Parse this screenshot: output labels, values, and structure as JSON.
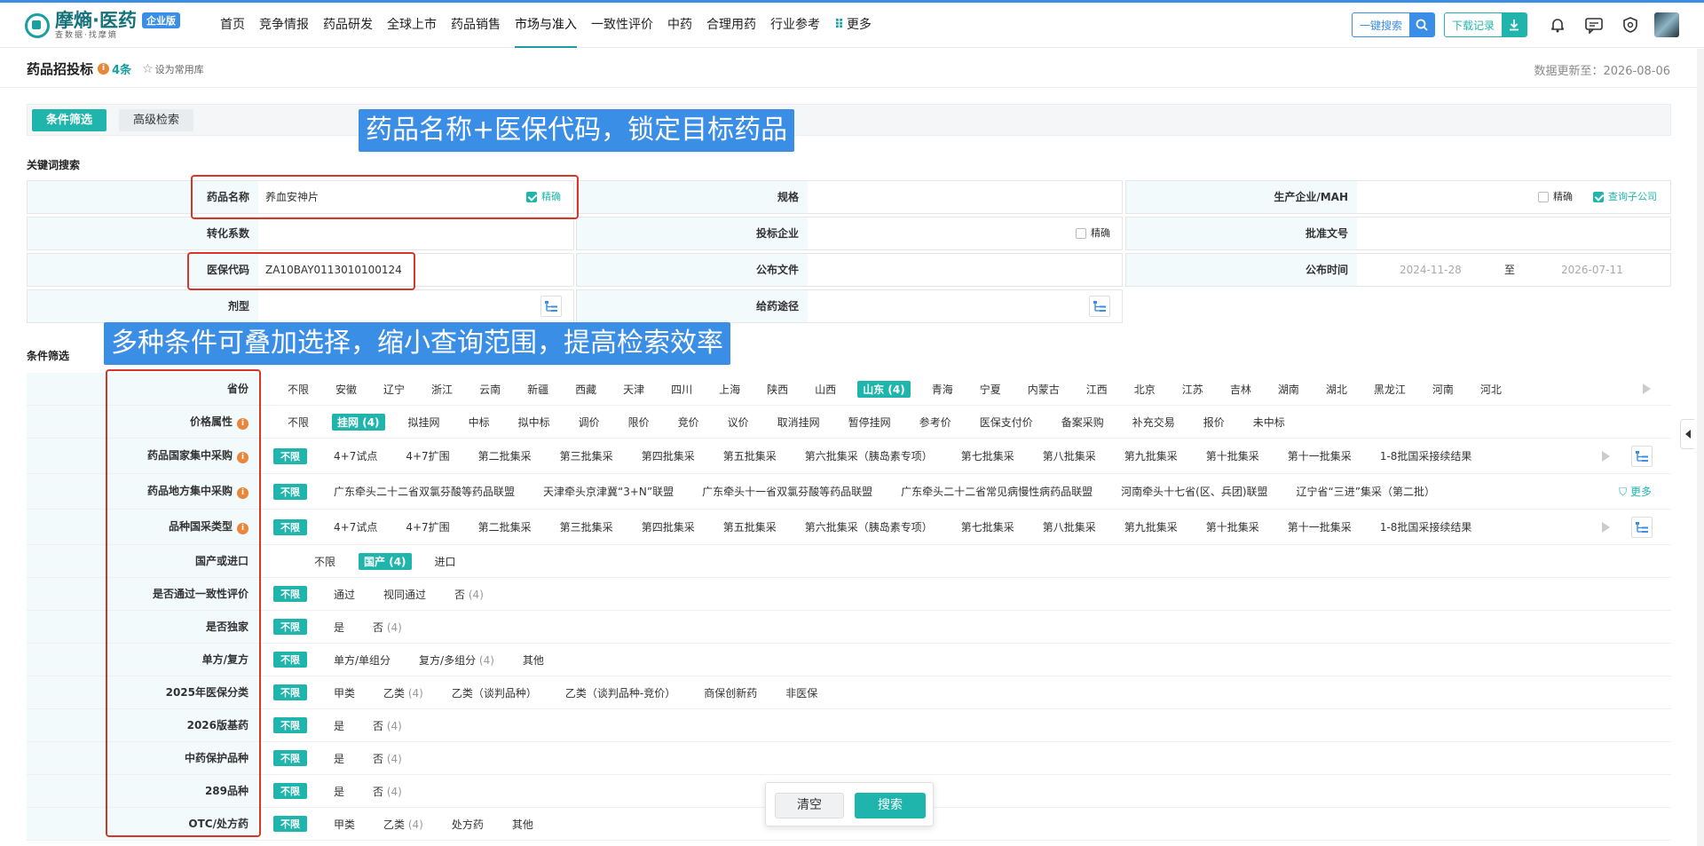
{
  "brand": {
    "name": "摩熵·医药",
    "slogan": "查数据·找摩熵",
    "edition": "企业版"
  },
  "nav": [
    "首页",
    "竞争情报",
    "药品研发",
    "全球上市",
    "药品销售",
    "市场与准入",
    "一致性评价",
    "中药",
    "合理用药",
    "行业参考"
  ],
  "nav_more": "更多",
  "header": {
    "search_btn": "一键搜索",
    "download_btn": "下载记录"
  },
  "page": {
    "title": "药品招投标",
    "count": "4条",
    "favorite": "设为常用库",
    "update_text": "数据更新至：2026-08-06"
  },
  "tabs": {
    "filter": "条件筛选",
    "advanced": "高级检索"
  },
  "sections": {
    "keyword": "关键词搜索",
    "filter": "条件筛选"
  },
  "keyword": {
    "drug_name_label": "药品名称",
    "drug_name_value": "养血安神片",
    "exact": "精确",
    "spec_label": "规格",
    "manufacturer_label": "生产企业/MAH",
    "query_sub": "查询子公司",
    "conversion_label": "转化系数",
    "bidder_label": "投标企业",
    "approval_label": "批准文号",
    "insurance_code_label": "医保代码",
    "insurance_code_value": "ZA10BAY0113010100124",
    "publish_doc_label": "公布文件",
    "publish_time_label": "公布时间",
    "date_from": "2024-11-28",
    "date_to_sep": "至",
    "date_to": "2026-07-11",
    "dosage_label": "剂型",
    "route_label": "给药途径"
  },
  "filters": {
    "province": {
      "label": "省份",
      "options": [
        "不限",
        "安徽",
        "辽宁",
        "浙江",
        "云南",
        "新疆",
        "西藏",
        "天津",
        "四川",
        "上海",
        "陕西",
        "山西",
        "山东",
        "青海",
        "宁夏",
        "内蒙古",
        "江西",
        "北京",
        "江苏",
        "吉林",
        "湖南",
        "湖北",
        "黑龙江",
        "河南",
        "河北"
      ],
      "selected": "山东",
      "selected_count": "(4)"
    },
    "price": {
      "label": "价格属性",
      "options": [
        "不限",
        "挂网",
        "拟挂网",
        "中标",
        "拟中标",
        "调价",
        "限价",
        "竞价",
        "议价",
        "取消挂网",
        "暂停挂网",
        "参考价",
        "医保支付价",
        "备案采购",
        "补充交易",
        "报价",
        "未中标"
      ],
      "selected": "挂网",
      "selected_count": "(4)"
    },
    "national": {
      "label": "药品国家集中采购",
      "pill": "不限",
      "options": [
        "4+7试点",
        "4+7扩围",
        "第二批集采",
        "第三批集采",
        "第四批集采",
        "第五批集采",
        "第六批集采（胰岛素专项）",
        "第七批集采",
        "第八批集采",
        "第九批集采",
        "第十批集采",
        "第十一批集采",
        "1-8批国采接续结果"
      ]
    },
    "local": {
      "label": "药品地方集中采购",
      "pill": "不限",
      "options": [
        "广东牵头二十二省双氯芬酸等药品联盟",
        "天津牵头京津冀“3+N”联盟",
        "广东牵头十一省双氯芬酸等药品联盟",
        "广东牵头二十二省常见病慢性病药品联盟",
        "河南牵头十七省(区、兵团)联盟",
        "辽宁省“三进”集采（第二批）"
      ],
      "more": "更多"
    },
    "variety": {
      "label": "品种国采类型",
      "pill": "不限",
      "options": [
        "4+7试点",
        "4+7扩围",
        "第二批集采",
        "第三批集采",
        "第四批集采",
        "第五批集采",
        "第六批集采（胰岛素专项）",
        "第七批集采",
        "第八批集采",
        "第九批集采",
        "第十批集采",
        "第十一批集采",
        "1-8批国采接续结果"
      ]
    },
    "domestic": {
      "label": "国产或进口",
      "options": [
        "不限",
        "国产",
        "进口"
      ],
      "selected": "国产",
      "selected_count": "(4)"
    },
    "consistency": {
      "label": "是否通过一致性评价",
      "pill": "不限",
      "options": [
        "通过",
        "视同通过",
        "否"
      ],
      "count_on": "否",
      "count": "(4)"
    },
    "exclusive": {
      "label": "是否独家",
      "pill": "不限",
      "options": [
        "是",
        "否"
      ],
      "count_on": "否",
      "count": "(4)"
    },
    "formula": {
      "label": "单方/复方",
      "pill": "不限",
      "options": [
        "单方/单组分",
        "复方/多组分",
        "其他"
      ],
      "count_on": "复方/多组分",
      "count": "(4)"
    },
    "insurance2025": {
      "label": "2025年医保分类",
      "pill": "不限",
      "options": [
        "甲类",
        "乙类",
        "乙类（谈判品种）",
        "乙类（谈判品种-竞价）",
        "商保创新药",
        "非医保"
      ],
      "count_on": "乙类",
      "count": "(4)"
    },
    "basic2026": {
      "label": "2026版基药",
      "pill": "不限",
      "options": [
        "是",
        "否"
      ],
      "count_on": "否",
      "count": "(4)"
    },
    "tcm_protect": {
      "label": "中药保护品种",
      "pill": "不限",
      "options": [
        "是",
        "否"
      ],
      "count_on": "否",
      "count": "(4)"
    },
    "v289": {
      "label": "289品种",
      "pill": "不限",
      "options": [
        "是",
        "否"
      ],
      "count_on": "否",
      "count": "(4)"
    },
    "otc": {
      "label": "OTC/处方药",
      "pill": "不限",
      "options": [
        "甲类",
        "乙类",
        "处方药",
        "其他"
      ],
      "count_on": "乙类",
      "count": "(4)"
    }
  },
  "annotations": {
    "a1": "药品名称+医保代码，锁定目标药品",
    "a2": "多种条件可叠加选择，缩小查询范围，提高检索效率"
  },
  "actions": {
    "clear": "清空",
    "search": "搜索"
  },
  "colors": {
    "teal": "#1fb5ad",
    "blue": "#3a8ee6",
    "red": "#d9362a",
    "orange": "#e8863a"
  }
}
